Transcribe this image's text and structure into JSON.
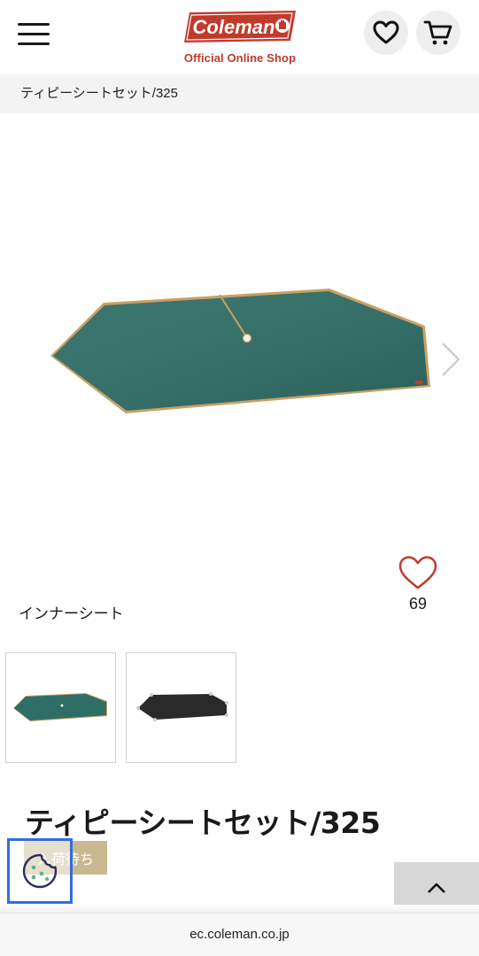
{
  "header": {
    "menu_icon": "hamburger-menu-icon",
    "logo_brand": "Coleman",
    "logo_subtitle": "Official Online Shop",
    "favorites_icon": "heart-icon",
    "cart_icon": "cart-icon"
  },
  "breadcrumb": {
    "current": "ティピーシートセット/325"
  },
  "gallery": {
    "main_image": "green-groundsheet-image",
    "next_icon": "chevron-right-icon",
    "caption": "インナーシート",
    "like_icon": "heart-outline-icon",
    "like_count": "69",
    "thumbnails": [
      {
        "image": "green-sheet-thumbnail"
      },
      {
        "image": "black-sheet-thumbnail"
      }
    ]
  },
  "product": {
    "title": "ティピーシートセット/325",
    "stock_status": "入荷待ち"
  },
  "floating": {
    "cookie_icon": "cookie-icon",
    "scroll_top_icon": "chevron-up-icon"
  },
  "browser": {
    "url": "ec.coleman.co.jp"
  },
  "colors": {
    "brand_red": "#c23a2b",
    "sheet_green": "#2f6e66",
    "badge_tan": "#c9b990",
    "focus_blue": "#2f6fdb"
  }
}
